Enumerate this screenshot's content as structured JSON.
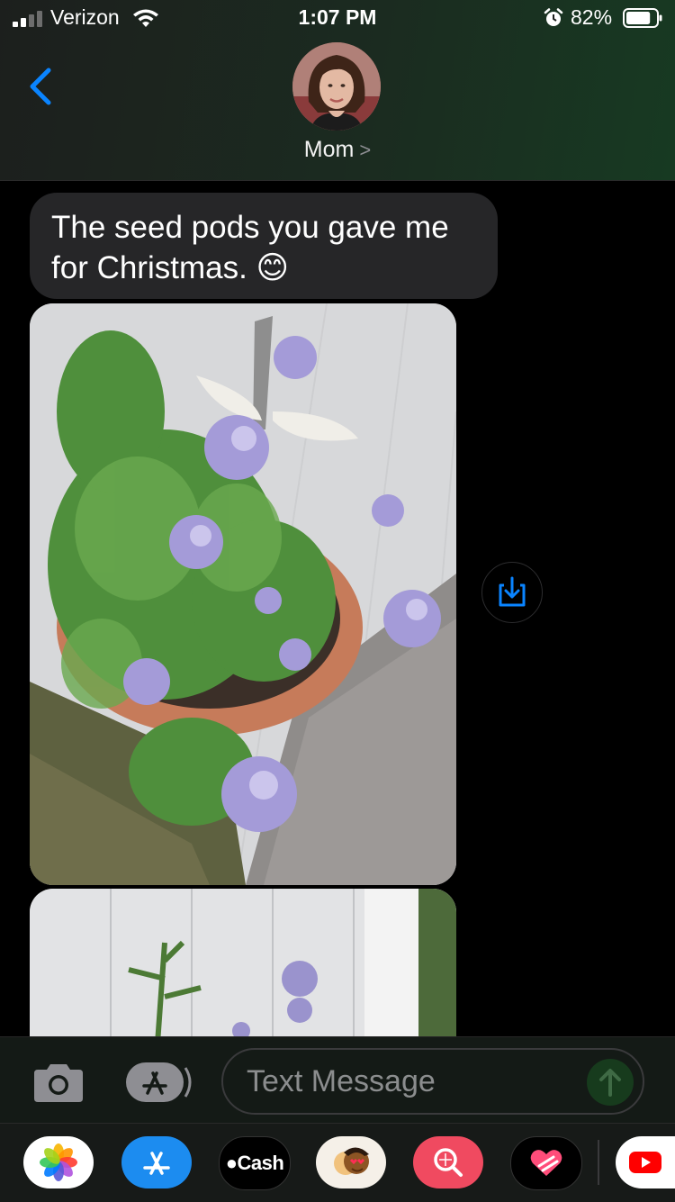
{
  "status": {
    "carrier": "Verizon",
    "time": "1:07 PM",
    "battery_percent": "82%",
    "battery_level": 0.82,
    "signal_bars_active": 2,
    "signal_bars_total": 4
  },
  "header": {
    "contact_name": "Mom",
    "name_chevron": ">"
  },
  "messages": [
    {
      "type": "text",
      "direction": "incoming",
      "text": "The seed pods you gave me for Christmas. 😊"
    },
    {
      "type": "photo",
      "direction": "incoming"
    },
    {
      "type": "photo",
      "direction": "incoming"
    }
  ],
  "compose": {
    "placeholder": "Text Message"
  },
  "app_drawer": {
    "apps": [
      {
        "name": "photos-icon"
      },
      {
        "name": "app-store-icon"
      },
      {
        "name": "apple-cash-icon",
        "label": "Cash"
      },
      {
        "name": "memoji-icon"
      },
      {
        "name": "image-search-icon"
      },
      {
        "name": "heart-app-icon"
      },
      {
        "name": "youtube-icon"
      }
    ]
  },
  "colors": {
    "accent_blue": "#0a84ff",
    "bubble_gray": "#262628",
    "header_green": "#1b2b20",
    "send_green": "#173b1d"
  }
}
